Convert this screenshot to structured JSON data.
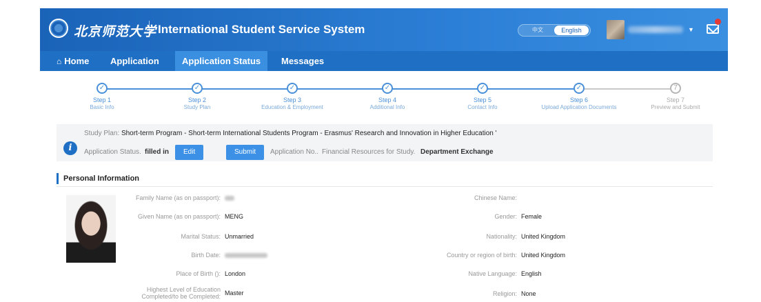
{
  "header": {
    "logo_text": "北京师范大学",
    "system_title": "International Student Service System",
    "lang_zh": "中文",
    "lang_en": "English",
    "accent": "#1f6fc4"
  },
  "nav": {
    "home": "Home",
    "application": "Application",
    "application_status": "Application Status",
    "messages": "Messages"
  },
  "steps": [
    {
      "title": "Step 1",
      "sub": "Basic Info",
      "done": true
    },
    {
      "title": "Step 2",
      "sub": "Study Plan",
      "done": true
    },
    {
      "title": "Step 3",
      "sub": "Education & Employment",
      "done": true
    },
    {
      "title": "Step 4",
      "sub": "Additional Info",
      "done": true
    },
    {
      "title": "Step 5",
      "sub": "Contact Info",
      "done": true
    },
    {
      "title": "Step 6",
      "sub": "Upload Application Documents",
      "done": true
    },
    {
      "title": "Step 7",
      "sub": "Preview and Submit",
      "done": false,
      "number": "7"
    }
  ],
  "info": {
    "plan_label": "Study Plan:",
    "plan_value": "Short-term Program - Short-term International Students Program - Erasmus' Research and Innovation in Higher Education '",
    "status_label": "Application Status.",
    "status_value": "filled in",
    "edit_button": "Edit",
    "submit_button": "Submit",
    "app_no_label": "Application No..",
    "funding_label": "Financial Resources for Study.",
    "funding_value": "Department Exchange"
  },
  "personal": {
    "section_title": "Personal Information",
    "left": [
      {
        "label": "Family Name (as on passport):",
        "value": ""
      },
      {
        "label": "Given Name (as on passport):",
        "value": "MENG"
      },
      {
        "label": "Marital Status:",
        "value": "Unmarried"
      },
      {
        "label": "Birth Date:",
        "value": ""
      },
      {
        "label": "Place of Birth ():",
        "value": "London"
      },
      {
        "label": "Highest Level of Education Completed/to be Completed:",
        "value": "Master"
      }
    ],
    "right": [
      {
        "label": "Chinese Name:",
        "value": ""
      },
      {
        "label": "Gender:",
        "value": "Female"
      },
      {
        "label": "Nationality:",
        "value": "United Kingdom"
      },
      {
        "label": "Country or region of birth:",
        "value": "United Kingdom"
      },
      {
        "label": "Native Language:",
        "value": "English"
      },
      {
        "label": "Religion:",
        "value": "None"
      }
    ]
  }
}
